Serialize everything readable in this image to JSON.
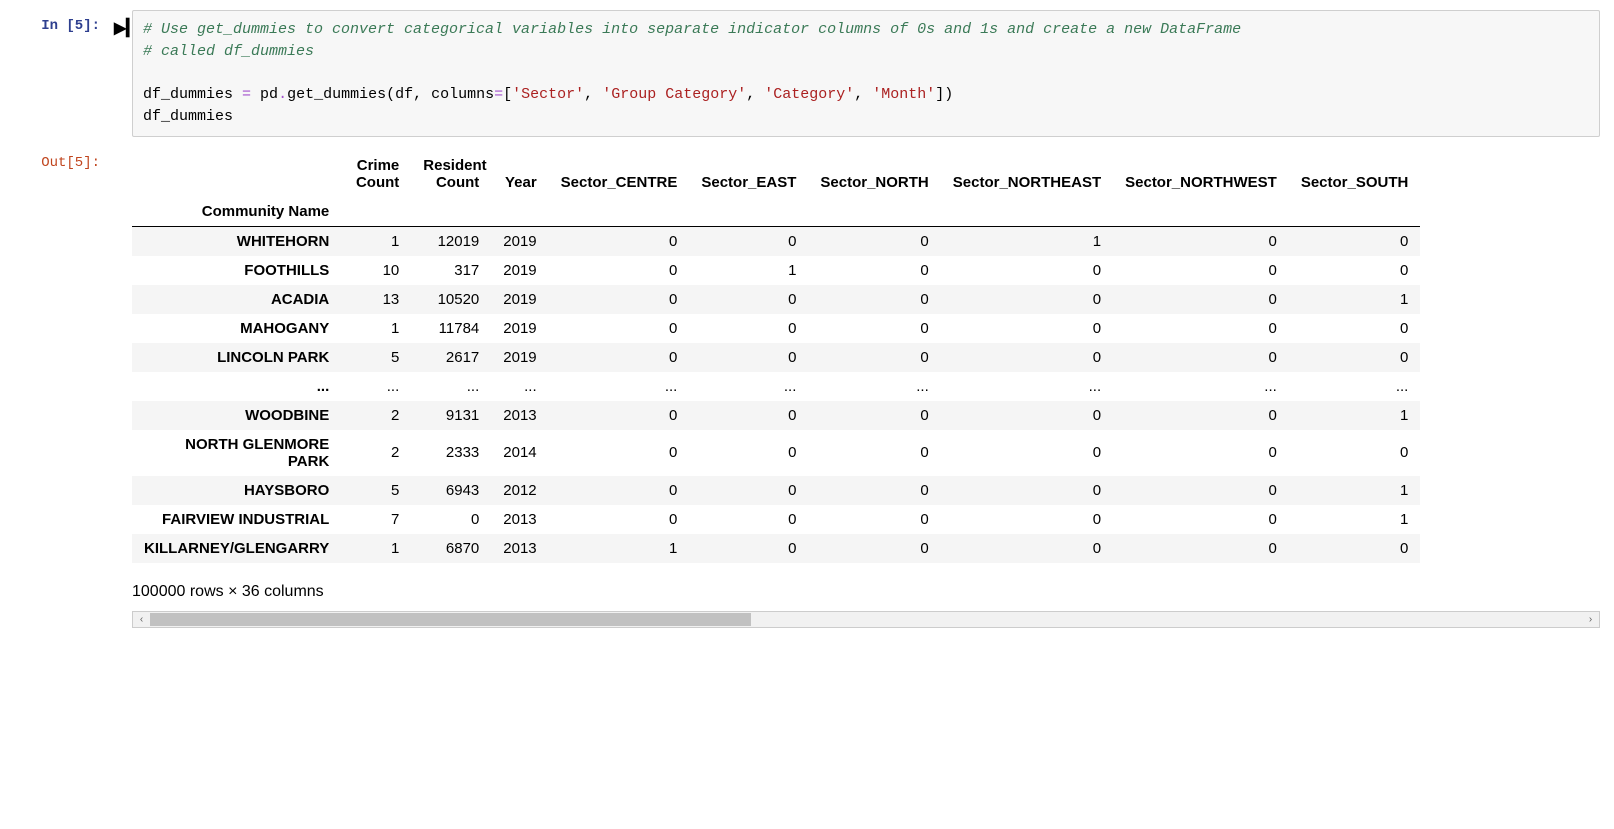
{
  "input_cell": {
    "prompt": "In [5]:",
    "run_icon": "▶▎",
    "code": {
      "comment1": "# Use get_dummies to convert categorical variables into separate indicator columns of 0s and 1s and create a new DataFrame",
      "comment2": "# called df_dummies",
      "line3_parts": {
        "lhs": "df_dummies ",
        "eq": "=",
        "mid": " pd",
        "dot": ".",
        "fn": "get_dummies(df, columns",
        "eq2": "=",
        "br": "[",
        "s1": "'Sector'",
        "c1": ", ",
        "s2": "'Group Category'",
        "c2": ", ",
        "s3": "'Category'",
        "c3": ", ",
        "s4": "'Month'",
        "brc": "])"
      },
      "line4": "df_dummies"
    }
  },
  "output_cell": {
    "prompt": "Out[5]:",
    "columns": [
      "Crime Count",
      "Resident Count",
      "Year",
      "Sector_CENTRE",
      "Sector_EAST",
      "Sector_NORTH",
      "Sector_NORTHEAST",
      "Sector_NORTHWEST",
      "Sector_SOUTH"
    ],
    "index_name": "Community Name",
    "rows": [
      {
        "idx": "WHITEHORN",
        "v": [
          "1",
          "12019",
          "2019",
          "0",
          "0",
          "0",
          "1",
          "0",
          "0"
        ]
      },
      {
        "idx": "FOOTHILLS",
        "v": [
          "10",
          "317",
          "2019",
          "0",
          "1",
          "0",
          "0",
          "0",
          "0"
        ]
      },
      {
        "idx": "ACADIA",
        "v": [
          "13",
          "10520",
          "2019",
          "0",
          "0",
          "0",
          "0",
          "0",
          "1"
        ]
      },
      {
        "idx": "MAHOGANY",
        "v": [
          "1",
          "11784",
          "2019",
          "0",
          "0",
          "0",
          "0",
          "0",
          "0"
        ]
      },
      {
        "idx": "LINCOLN PARK",
        "v": [
          "5",
          "2617",
          "2019",
          "0",
          "0",
          "0",
          "0",
          "0",
          "0"
        ]
      },
      {
        "idx": "...",
        "v": [
          "...",
          "...",
          "...",
          "...",
          "...",
          "...",
          "...",
          "...",
          "..."
        ]
      },
      {
        "idx": "WOODBINE",
        "v": [
          "2",
          "9131",
          "2013",
          "0",
          "0",
          "0",
          "0",
          "0",
          "1"
        ]
      },
      {
        "idx": "NORTH GLENMORE PARK",
        "v": [
          "2",
          "2333",
          "2014",
          "0",
          "0",
          "0",
          "0",
          "0",
          "0"
        ]
      },
      {
        "idx": "HAYSBORO",
        "v": [
          "5",
          "6943",
          "2012",
          "0",
          "0",
          "0",
          "0",
          "0",
          "1"
        ]
      },
      {
        "idx": "FAIRVIEW INDUSTRIAL",
        "v": [
          "7",
          "0",
          "2013",
          "0",
          "0",
          "0",
          "0",
          "0",
          "1"
        ]
      },
      {
        "idx": "KILLARNEY/GLENGARRY",
        "v": [
          "1",
          "6870",
          "2013",
          "1",
          "0",
          "0",
          "0",
          "0",
          "0"
        ]
      }
    ],
    "footer": "100000 rows × 36 columns"
  },
  "scroll": {
    "left_arrow": "‹",
    "right_arrow": "›"
  }
}
